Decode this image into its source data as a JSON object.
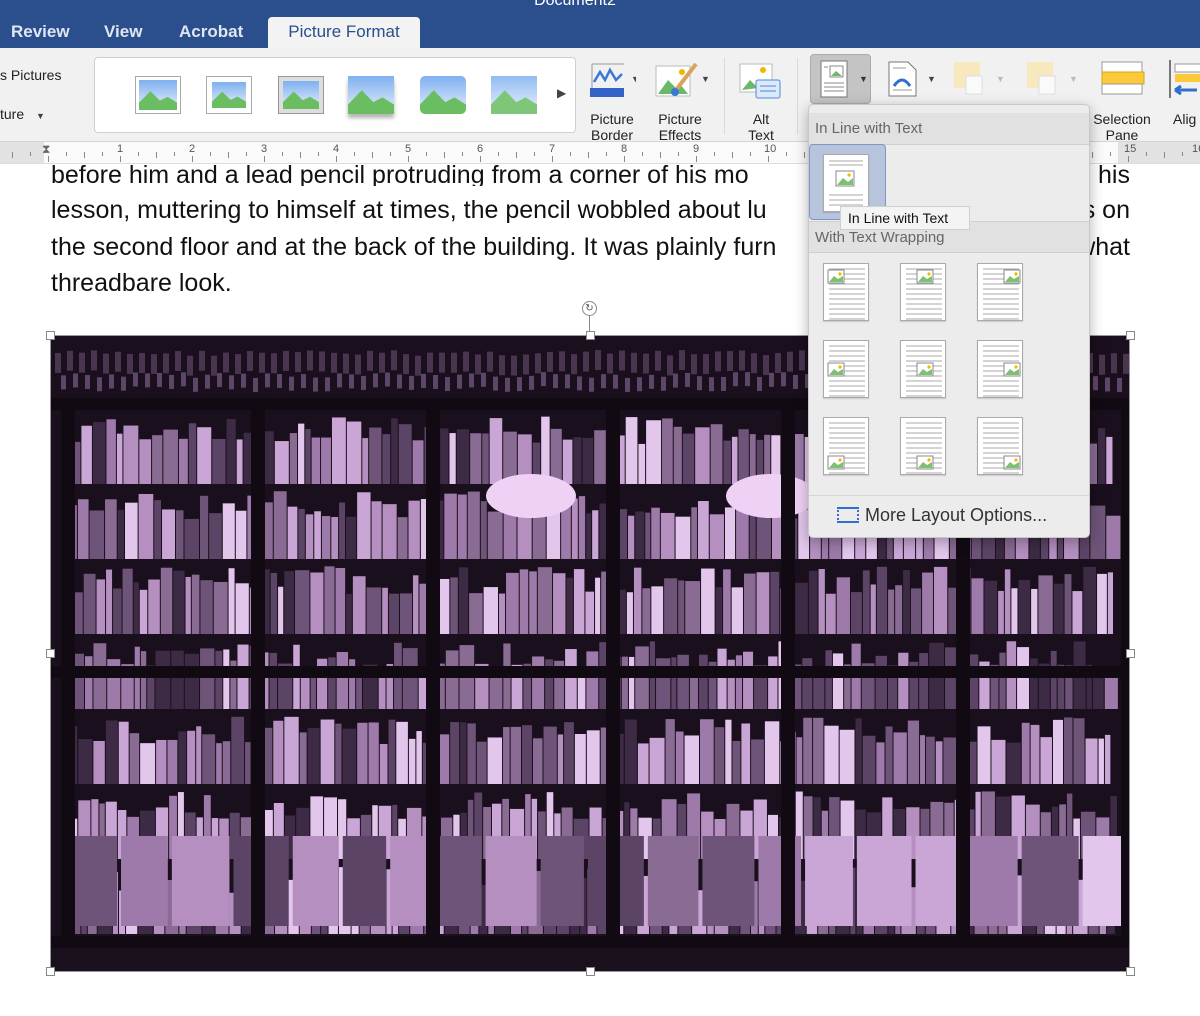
{
  "window": {
    "title": "Document2"
  },
  "tabs": [
    {
      "label": "Review"
    },
    {
      "label": "View"
    },
    {
      "label": "Acrobat"
    },
    {
      "label": "Picture Format",
      "active": true
    }
  ],
  "ribbon": {
    "left_items": [
      "s Pictures",
      "ture"
    ],
    "picture_styles_count": 6,
    "buttons": {
      "picture_border": [
        "Picture",
        "Border"
      ],
      "picture_effects": [
        "Picture",
        "Effects"
      ],
      "alt_text": [
        "Alt",
        "Text"
      ],
      "selection_pane": [
        "Selection",
        "Pane"
      ],
      "align": "Alig"
    }
  },
  "ruler": {
    "numbers": [
      "1",
      "2",
      "3",
      "4",
      "5",
      "6",
      "7",
      "8",
      "9",
      "10",
      "15",
      "16"
    ]
  },
  "document": {
    "lines": [
      {
        "left": "before him and a lead pencil protruding from a corner of his mo",
        "right": "his"
      },
      {
        "left": "lesson, muttering to himself at times, the pencil wobbled about lu",
        "right": "s on"
      },
      {
        "left": "the second floor and at the back of the building. It was plainly furn",
        "right": "what"
      },
      {
        "left": "threadbare look.",
        "right": ""
      }
    ]
  },
  "wrap_menu": {
    "section_inline": "In Line with Text",
    "section_wrapping": "With Text Wrapping",
    "tooltip": "In Line with Text",
    "more_options": "More Layout Options..."
  },
  "colors": {
    "title_bar": "#2b4e8c",
    "image_tint": "#c9a0d8",
    "selection_highlight": "#b7c4dc"
  }
}
